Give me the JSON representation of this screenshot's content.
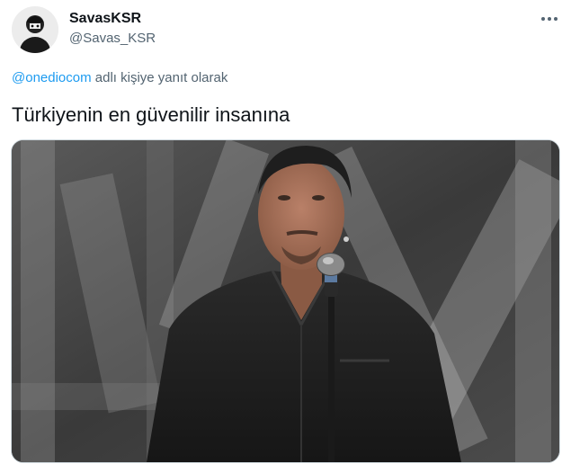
{
  "author": {
    "display_name": "SavasKSR",
    "handle": "@Savas_KSR",
    "avatar_icon": "avatar-image"
  },
  "more_icon": "more-horizontal-icon",
  "reply_context": {
    "mention": "@onediocom",
    "suffix": " adlı kişiye yanıt olarak"
  },
  "tweet_text": "Türkiyenin en güvenilir insanına",
  "media": {
    "description_icon": "tweet-photo",
    "colors": {
      "background": "#3d3d3d",
      "shirt": "#1c1c1c",
      "skin": "#a47258",
      "microphone": "#8a8a8a"
    }
  },
  "colors": {
    "text": "#0f1419",
    "secondary": "#536471",
    "link": "#1d9bf0",
    "border": "#cfd9de"
  }
}
